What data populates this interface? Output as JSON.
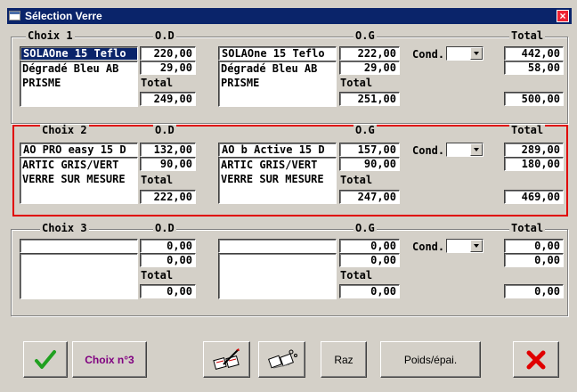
{
  "window": {
    "title": "Sélection Verre"
  },
  "headers": {
    "od": "O.D",
    "og": "O.G",
    "total": "Total",
    "cond": "Cond.",
    "subtotal": "Total"
  },
  "groups": [
    {
      "label": "Choix 1",
      "od_product": "SOLAOne 15 Teflo",
      "od_price": "220,00",
      "od_line2": "Dégradé Bleu AB",
      "od_line2_price": "29,00",
      "od_line3": "PRISME",
      "od_total": "249,00",
      "og_product": "SOLAOne 15 Teflo",
      "og_price": "222,00",
      "og_line2": "Dégradé Bleu AB",
      "og_line2_price": "29,00",
      "og_line3": "PRISME",
      "og_total": "251,00",
      "total_1": "442,00",
      "total_2": "58,00",
      "grand_total": "500,00"
    },
    {
      "label": "Choix 2",
      "od_product": "AO PRO easy 15 D",
      "od_price": "132,00",
      "od_line2": "ARTIC GRIS/VERT",
      "od_line2_price": "90,00",
      "od_line3": "VERRE SUR MESURE",
      "od_total": "222,00",
      "og_product": "AO b Active 15 D",
      "og_price": "157,00",
      "og_line2": "ARTIC GRIS/VERT",
      "og_line2_price": "90,00",
      "og_line3": "VERRE SUR MESURE",
      "og_total": "247,00",
      "total_1": "289,00",
      "total_2": "180,00",
      "grand_total": "469,00"
    },
    {
      "label": "Choix 3",
      "od_product": "",
      "od_price": "0,00",
      "od_line2": "",
      "od_line2_price": "0,00",
      "od_line3": "",
      "od_total": "0,00",
      "og_product": "",
      "og_price": "0,00",
      "og_line2": "",
      "og_line2_price": "0,00",
      "og_line3": "",
      "og_total": "0,00",
      "total_1": "0,00",
      "total_2": "0,00",
      "grand_total": "0,00"
    }
  ],
  "buttons": {
    "choix": "Choix n°3",
    "raz": "Raz",
    "poids": "Poids/épai."
  },
  "colors": {
    "title_bar": "#0a246a",
    "selection_border": "#e00000",
    "ok_check": "#20a020",
    "cancel_x": "#e00000",
    "choix_label": "#800080"
  }
}
